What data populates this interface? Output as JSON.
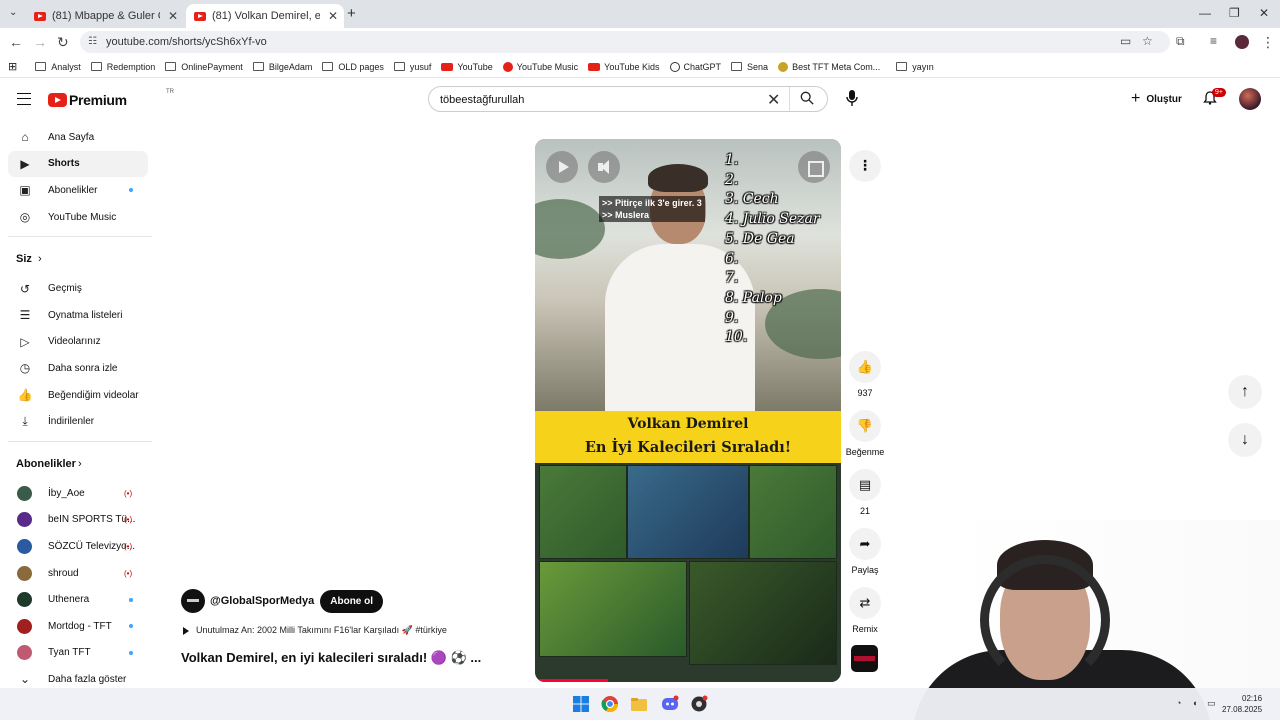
{
  "browser": {
    "tabs": [
      {
        "title": "(81) Mbappe & Guler Chemistry"
      },
      {
        "title": "(81) Volkan Demirel, en iyi kaleci"
      }
    ],
    "url": "youtube.com/shorts/ycSh6xYf-vo",
    "bookmarks": [
      "Analyst",
      "Redemption",
      "OnlinePayment",
      "BilgeAdam",
      "OLD pages",
      "yusuf",
      "YouTube",
      "YouTube Music",
      "YouTube Kids",
      "ChatGPT",
      "Sena",
      "Best TFT Meta Com...",
      "yayın"
    ]
  },
  "header": {
    "logo": "Premium",
    "region": "TR",
    "search_query": "töbeestağfurullah",
    "create_label": "Oluştur",
    "notif_badge": "9+"
  },
  "sidebar": {
    "main": [
      {
        "label": "Ana Sayfa",
        "icon": "home-icon"
      },
      {
        "label": "Shorts",
        "icon": "shorts-icon",
        "active": true
      },
      {
        "label": "Abonelikler",
        "icon": "subscriptions-icon"
      },
      {
        "label": "YouTube Music",
        "icon": "youtube-music-icon"
      }
    ],
    "you_heading": "Siz",
    "you": [
      {
        "label": "Geçmiş",
        "icon": "history-icon"
      },
      {
        "label": "Oynatma listeleri",
        "icon": "playlists-icon"
      },
      {
        "label": "Videolarınız",
        "icon": "your-videos-icon"
      },
      {
        "label": "Daha sonra izle",
        "icon": "watch-later-icon"
      },
      {
        "label": "Beğendiğim videolar",
        "icon": "liked-videos-icon"
      },
      {
        "label": "İndirilenler",
        "icon": "downloads-icon"
      }
    ],
    "subs_heading": "Abonelikler",
    "subs": [
      {
        "label": "İby_Aoe",
        "status": "live",
        "color": "#3a5a4a"
      },
      {
        "label": "beIN SPORTS Tü...",
        "status": "live",
        "color": "#5a2a8a"
      },
      {
        "label": "SÖZCÜ Televizyo...",
        "status": "live",
        "color": "#2a5aa0"
      },
      {
        "label": "shroud",
        "status": "live",
        "color": "#8a6a3a"
      },
      {
        "label": "Uthenera",
        "status": "dot",
        "color": "#1d3a2a"
      },
      {
        "label": "Mortdog - TFT",
        "status": "dot",
        "color": "#a02020"
      },
      {
        "label": "Tyan TFT",
        "status": "dot",
        "color": "#c05a70"
      }
    ],
    "show_more": "Daha fazla göster"
  },
  "video": {
    "overlay_text_1": ">> Pitirçe ilk 3'e girer. 3",
    "overlay_text_2": ">> Muslera",
    "ranking": [
      "1.",
      "2.",
      "3. Cech",
      "4. Julio Sezar",
      "5. De Gea",
      "6.",
      "7.",
      "8. Palop",
      "9.",
      "10."
    ],
    "banner_line1": "Volkan Demirel",
    "banner_line2": "En İyi Kalecileri Sıraladı!",
    "progress_fraction": 0.24
  },
  "meta": {
    "channel": "@GlobalSporMedya",
    "subscribe": "Abone ol",
    "music": "Unutulmaz An: 2002 Milli Takımını F16'lar Karşıladı 🚀 #türkiye",
    "title": "Volkan Demirel, en iyi kalecileri sıraladı! 🟣 ⚽ ..."
  },
  "actions": {
    "likes": "937",
    "dislike_label": "Beğenme",
    "comments": "21",
    "share_label": "Paylaş",
    "remix_label": "Remix"
  },
  "taskbar": {
    "time": "02:16",
    "date": "27.08.2025"
  }
}
